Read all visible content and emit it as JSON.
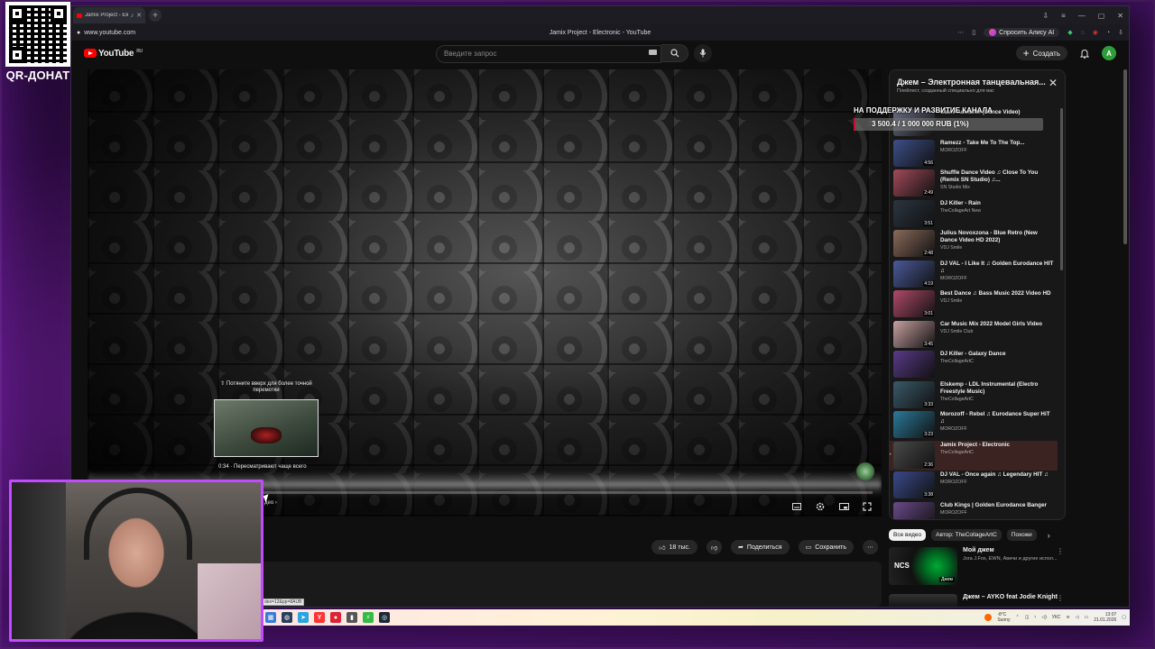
{
  "overlay": {
    "qr_caption": "QR-ДОНАТ",
    "donation": {
      "title": "НА ПОДДЕРЖКУ И РАЗВИТИЕ КАНАЛА",
      "progress_text": "3 500.4 / 1 000 000 RUB (1%)",
      "progress_fraction": 0.01,
      "fill_color": "#c8102e"
    }
  },
  "browser": {
    "tab_title": "Jamix Project - Elect",
    "url": "www.youtube.com",
    "page_title": "Jamix Project - Electronic - YouTube",
    "alice_button": "Спросить Алису AI"
  },
  "youtube": {
    "logo_text": "YouTube",
    "logo_sup": "RU",
    "search_placeholder": "Введите запрос",
    "create_label": "Создать",
    "avatar_letter": "A"
  },
  "player": {
    "seek_tip": "⇧ Потяните вверх для более точной перемотки",
    "preview_time": "0:34 · Пересматривают чаще всего",
    "play_next_hint": "део ›",
    "progress_fraction": 0.0
  },
  "actions": {
    "likes": "18 тыс.",
    "share": "Поделиться",
    "save": "Сохранить"
  },
  "playlist": {
    "title": "Джем – Электронная танцевальная...",
    "subtitle": "Плейлист, созданный специально для вас",
    "items": [
      {
        "title": "Sashi Adelante (Dance Video)",
        "channel": "",
        "duration": "",
        "thumb": "#6a6f85"
      },
      {
        "title": "Ramezz - Take Me To The Top...",
        "channel": "MOROZOFF",
        "duration": "4:56",
        "thumb": "#3d4f8a"
      },
      {
        "title": "Shuffle Dance Video ♫ Close To You (Remix SN Studio) ♫...",
        "channel": "SN Studio Mix",
        "duration": "2:49",
        "thumb": "#a24a5a"
      },
      {
        "title": "DJ Killer - Rain",
        "channel": "TheCollageArt New",
        "duration": "3:51",
        "thumb": "#2b3540"
      },
      {
        "title": "Julius Novoxzona - Blue Retro (New Dance Video HD 2022)",
        "channel": "VDJ Smile",
        "duration": "2:48",
        "thumb": "#8a6a5a"
      },
      {
        "title": "DJ VAL - I Like It ♫ Golden Eurodance HIT ♫",
        "channel": "MOROZOFF",
        "duration": "4:19",
        "thumb": "#4a5a9a"
      },
      {
        "title": "Best Dance ♫ Bass Music 2022 Video HD",
        "channel": "VDJ Smile",
        "duration": "3:01",
        "thumb": "#b04a6a"
      },
      {
        "title": "Car Music Mix 2022 Model Girls Video",
        "channel": "VDJ Smile Club",
        "duration": "3:45",
        "thumb": "#c8a0a0"
      },
      {
        "title": "DJ Killer - Galaxy Dance",
        "channel": "TheCollageArtC",
        "duration": "",
        "thumb": "#5a3a8a"
      },
      {
        "title": "Elskemp - LDL Instrumental (Electro Freestyle Music)",
        "channel": "TheCollageArtC",
        "duration": "3:33",
        "thumb": "#3a5a6a"
      },
      {
        "title": "Morozoff - Rebel ♫ Eurodance Super HiT ♫",
        "channel": "MOROZOFF",
        "duration": "3:23",
        "thumb": "#2a7a9a"
      },
      {
        "title": "Jamix Project - Electronic",
        "channel": "TheCollageArtC",
        "duration": "2:36",
        "thumb": "#4a4a4a",
        "active": true
      },
      {
        "title": "DJ VAL - Once again ♫ Legendary HIT ♫",
        "channel": "MOROZOFF",
        "duration": "3:38",
        "thumb": "#3a4a8a"
      },
      {
        "title": "Club Kings | Golden Eurodance Banger",
        "channel": "MOROZOFF",
        "duration": "3:59",
        "thumb": "#6a4a8a"
      }
    ]
  },
  "chips": {
    "all": "Все видео",
    "author": "Автор: TheCollageArtC",
    "similar": "Похожи"
  },
  "related": [
    {
      "title": "Мой джем",
      "subtitle": "Jora J.Fox, ÈWN, Авичи и другие испол...",
      "badge": "Джем",
      "thumb_label": "NCS"
    },
    {
      "title": "Джем – AYKO feat Jodie Knight",
      "subtitle": "",
      "badge": "",
      "thumb_label": ""
    }
  ],
  "taskbar": {
    "temperature": "-8°C",
    "weather": "Sunny",
    "language": "УКС",
    "time": "13:07",
    "date": "21.01.2026",
    "url_tooltip": "dex=12&pp=8AUB"
  }
}
